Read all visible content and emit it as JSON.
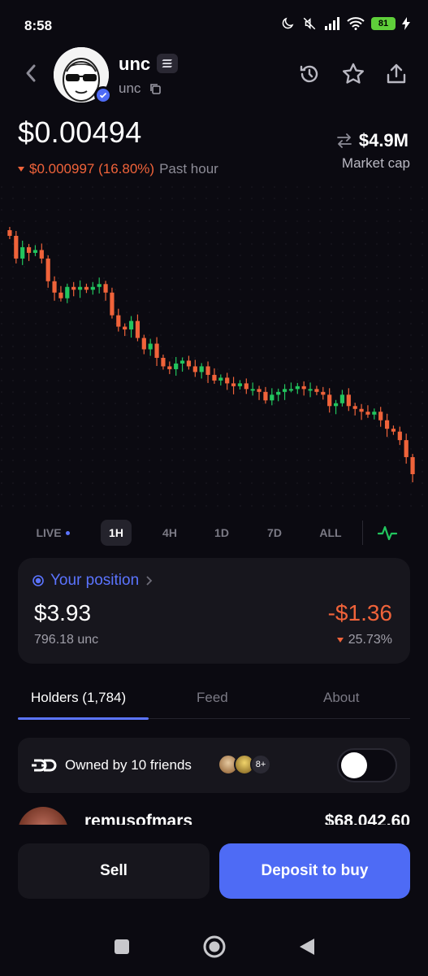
{
  "status": {
    "time": "8:58",
    "battery": "81"
  },
  "token": {
    "name": "unc",
    "ticker": "unc",
    "price": "$0.00494",
    "change_value": "$0.000997 (16.80%)",
    "change_period": "Past hour",
    "market_cap": "$4.9M",
    "market_cap_label": "Market cap"
  },
  "timeframes": [
    "LIVE",
    "1H",
    "4H",
    "1D",
    "7D",
    "ALL"
  ],
  "timeframe_active": "1H",
  "position": {
    "title": "Your position",
    "value": "$3.93",
    "quantity": "796.18 unc",
    "pnl": "-$1.36",
    "pnl_pct": "25.73%"
  },
  "tabs": [
    "Holders (1,784)",
    "Feed",
    "About"
  ],
  "friends": {
    "label": "Owned by 10 friends",
    "more": "8+",
    "toggle_on": false
  },
  "holder": {
    "name": "remusofmars",
    "amount": "$68,042.60"
  },
  "actions": {
    "sell": "Sell",
    "buy": "Deposit to buy"
  },
  "colors": {
    "up": "#22c55e",
    "down": "#f0633a",
    "accent": "#5b74ff",
    "primary_button": "#4e6bf5"
  },
  "chart_data": {
    "type": "candlestick",
    "trend": "down",
    "series": [
      {
        "o": 100,
        "c": 98
      },
      {
        "o": 98,
        "c": 90
      },
      {
        "o": 90,
        "c": 94
      },
      {
        "o": 94,
        "c": 92
      },
      {
        "o": 92,
        "c": 93
      },
      {
        "o": 93,
        "c": 90
      },
      {
        "o": 90,
        "c": 82
      },
      {
        "o": 82,
        "c": 78
      },
      {
        "o": 78,
        "c": 76
      },
      {
        "o": 76,
        "c": 80
      },
      {
        "o": 80,
        "c": 79
      },
      {
        "o": 79,
        "c": 80
      },
      {
        "o": 80,
        "c": 79
      },
      {
        "o": 79,
        "c": 80
      },
      {
        "o": 80,
        "c": 81
      },
      {
        "o": 81,
        "c": 78
      },
      {
        "o": 78,
        "c": 70
      },
      {
        "o": 70,
        "c": 66
      },
      {
        "o": 66,
        "c": 65
      },
      {
        "o": 65,
        "c": 68
      },
      {
        "o": 68,
        "c": 62
      },
      {
        "o": 62,
        "c": 58
      },
      {
        "o": 58,
        "c": 60
      },
      {
        "o": 60,
        "c": 55
      },
      {
        "o": 55,
        "c": 52
      },
      {
        "o": 52,
        "c": 51
      },
      {
        "o": 51,
        "c": 53
      },
      {
        "o": 53,
        "c": 54
      },
      {
        "o": 54,
        "c": 52
      },
      {
        "o": 52,
        "c": 50
      },
      {
        "o": 50,
        "c": 52
      },
      {
        "o": 52,
        "c": 49
      },
      {
        "o": 49,
        "c": 47
      },
      {
        "o": 47,
        "c": 48
      },
      {
        "o": 48,
        "c": 46
      },
      {
        "o": 46,
        "c": 45
      },
      {
        "o": 45,
        "c": 46
      },
      {
        "o": 46,
        "c": 44
      },
      {
        "o": 44,
        "c": 44
      },
      {
        "o": 44,
        "c": 43
      },
      {
        "o": 43,
        "c": 40
      },
      {
        "o": 40,
        "c": 42
      },
      {
        "o": 42,
        "c": 43
      },
      {
        "o": 43,
        "c": 44
      },
      {
        "o": 44,
        "c": 44
      },
      {
        "o": 44,
        "c": 45
      },
      {
        "o": 45,
        "c": 44
      },
      {
        "o": 44,
        "c": 44
      },
      {
        "o": 44,
        "c": 43
      },
      {
        "o": 43,
        "c": 42
      },
      {
        "o": 42,
        "c": 38
      },
      {
        "o": 38,
        "c": 39
      },
      {
        "o": 39,
        "c": 42
      },
      {
        "o": 42,
        "c": 38
      },
      {
        "o": 38,
        "c": 37
      },
      {
        "o": 37,
        "c": 36
      },
      {
        "o": 36,
        "c": 35
      },
      {
        "o": 35,
        "c": 36
      },
      {
        "o": 36,
        "c": 33
      },
      {
        "o": 33,
        "c": 30
      },
      {
        "o": 30,
        "c": 29
      },
      {
        "o": 29,
        "c": 26
      },
      {
        "o": 26,
        "c": 20
      },
      {
        "o": 20,
        "c": 14
      }
    ]
  }
}
